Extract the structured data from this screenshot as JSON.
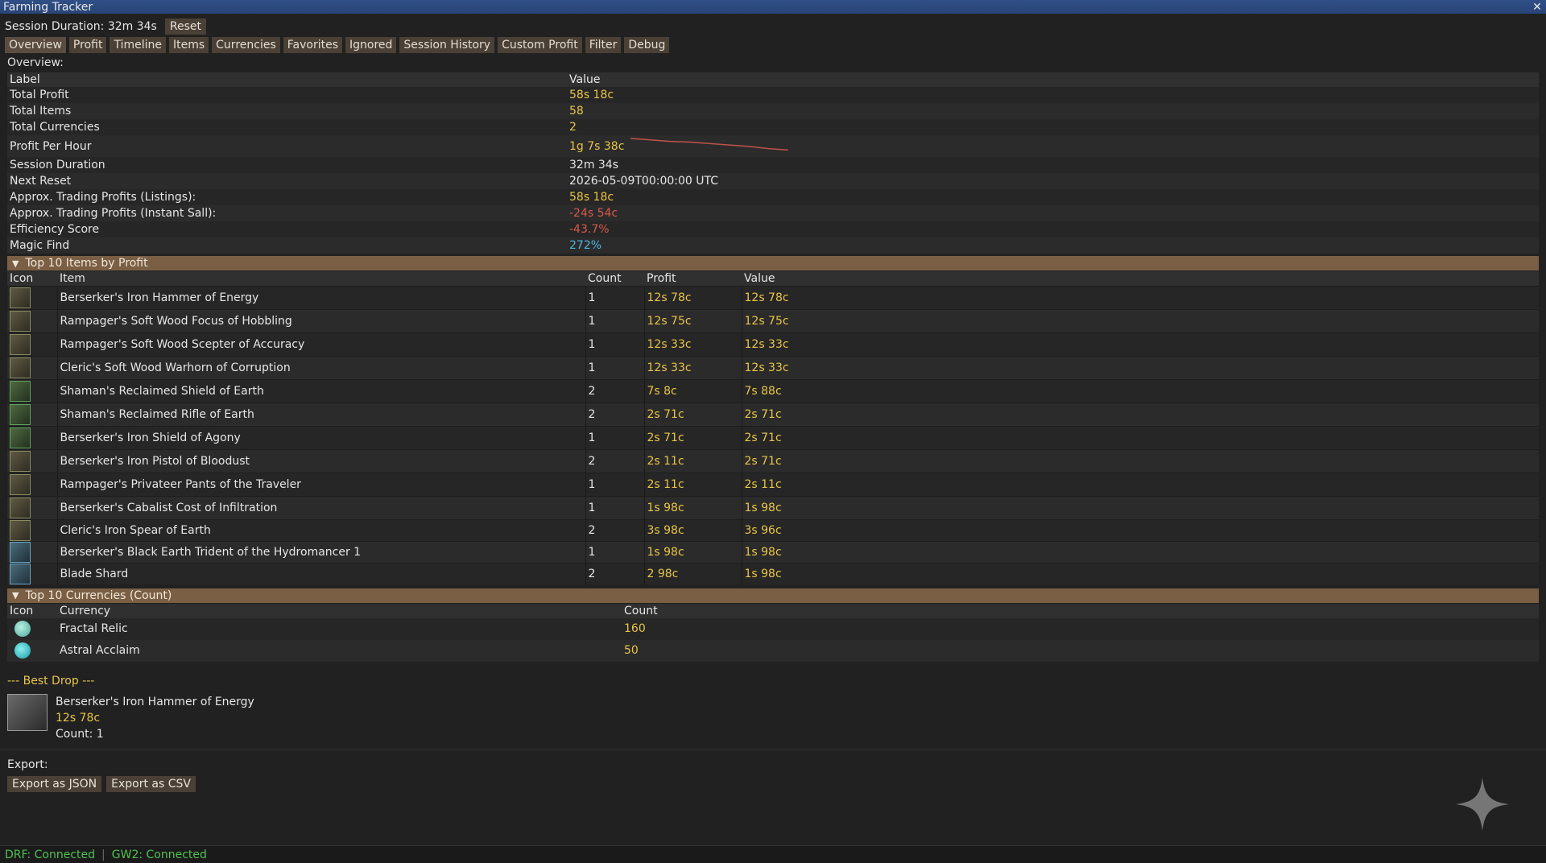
{
  "window": {
    "title": "Farming Tracker",
    "close": "✕"
  },
  "session": {
    "text": "Session Duration: 32m 34s",
    "reset_label": "Reset"
  },
  "tabs": [
    "Overview",
    "Profit",
    "Timeline",
    "Items",
    "Currencies",
    "Favorites",
    "Ignored",
    "Session History",
    "Custom Profit",
    "Filter",
    "Debug"
  ],
  "overview": {
    "section_label": "Overview:",
    "col_label": "Label",
    "col_value": "Value",
    "rows": [
      {
        "label": "Total Profit",
        "value": "58s 18c",
        "color": "gold"
      },
      {
        "label": "Total Items",
        "value": "58",
        "color": "gold"
      },
      {
        "label": "Total Currencies",
        "value": "2",
        "color": "gold"
      },
      {
        "label": "Profit Per Hour",
        "value": "1g 7s 38c",
        "color": "gold"
      },
      {
        "label": "Session Duration",
        "value": "32m 34s",
        "color": "white"
      },
      {
        "label": "Next Reset",
        "value": "2026-05-09T00:00:00 UTC",
        "color": "white"
      },
      {
        "label": "Approx. Trading Profits (Listings):",
        "value": "58s 18c",
        "color": "gold"
      },
      {
        "label": "Approx. Trading Profits (Instant Sall):",
        "value": "-24s 54c",
        "color": "red"
      },
      {
        "label": "Efficiency Score",
        "value": "-43.7%",
        "color": "red"
      },
      {
        "label": "Magic Find",
        "value": "272%",
        "color": "blue"
      }
    ]
  },
  "top_items": {
    "header": "Top 10 Items by Profit",
    "columns": [
      "Icon",
      "Item",
      "Count",
      "Profit",
      "Value"
    ],
    "rows": [
      {
        "item": "Berserker's Iron Hammer of Energy",
        "count": "1",
        "profit": "12s 78c",
        "value": "12s 78c",
        "icon": "hammer-icon"
      },
      {
        "item": "Rampager's Soft Wood Focus of Hobbling",
        "count": "1",
        "profit": "12s 75c",
        "value": "12s 75c",
        "icon": "focus-icon"
      },
      {
        "item": "Rampager's Soft Wood Scepter of Accuracy",
        "count": "1",
        "profit": "12s 33c",
        "value": "12s 33c",
        "icon": "scepter-icon"
      },
      {
        "item": "Cleric's Soft Wood Warhorn of Corruption",
        "count": "1",
        "profit": "12s 33c",
        "value": "12s 33c",
        "icon": "warhorn-icon"
      },
      {
        "item": "Shaman's Reclaimed Shield of Earth",
        "count": "2",
        "profit": "7s 8c",
        "value": "7s 88c",
        "icon": "shield-icon"
      },
      {
        "item": "Shaman's Reclaimed Rifle of Earth",
        "count": "2",
        "profit": "2s 71c",
        "value": "2s 71c",
        "icon": "rifle-icon"
      },
      {
        "item": "Berserker's Iron Shield of Agony",
        "count": "1",
        "profit": "2s 71c",
        "value": "2s 71c",
        "icon": "shield-icon"
      },
      {
        "item": "Berserker's Iron Pistol of Bloodust",
        "count": "2",
        "profit": "2s 11c",
        "value": "2s 71c",
        "icon": "pistol-icon"
      },
      {
        "item": "Rampager's Privateer Pants of the Traveler",
        "count": "1",
        "profit": "2s 11c",
        "value": "2s 11c",
        "icon": "pants-icon"
      },
      {
        "item": "Berserker's Cabalist Cost of Infiltration",
        "count": "1",
        "profit": "1s 98c",
        "value": "1s 98c",
        "icon": "coat-icon"
      },
      {
        "item": "Cleric's Iron Spear of Earth",
        "count": "2",
        "profit": "3s 98c",
        "value": "3s 96c",
        "icon": "spear-icon"
      },
      {
        "item": "Berserker's Black Earth Trident of the Hydromancer 1",
        "count": "1",
        "profit": "1s 98c",
        "value": "1s 98c",
        "icon": "trident-icon"
      },
      {
        "item": "Blade Shard",
        "count": "2",
        "profit": "2 98c",
        "value": "1s 98c",
        "icon": "blade-shard-icon"
      }
    ]
  },
  "top_currencies": {
    "header": "Top 10 Currencies (Count)",
    "columns": [
      "Icon",
      "Currency",
      "Count"
    ],
    "rows": [
      {
        "currency": "Fractal Relic",
        "count": "160",
        "icon": "fractal-relic-icon"
      },
      {
        "currency": "Astral Acclaim",
        "count": "50",
        "icon": "astral-acclaim-icon"
      }
    ]
  },
  "best_drop": {
    "title": "--- Best Drop ---",
    "item": "Berserker's Iron Hammer of Energy",
    "value": "12s 78c",
    "count": "Count: 1"
  },
  "export": {
    "label": "Export:",
    "json_label": "Export as JSON",
    "csv_label": "Export as CSV"
  },
  "status": {
    "drf": "DRF: Connected",
    "gw2": "GW2: Connected"
  },
  "sparkline": {
    "trend": [
      1.0,
      0.96,
      0.92,
      0.9,
      0.86,
      0.82,
      0.78,
      0.72,
      0.68
    ]
  }
}
